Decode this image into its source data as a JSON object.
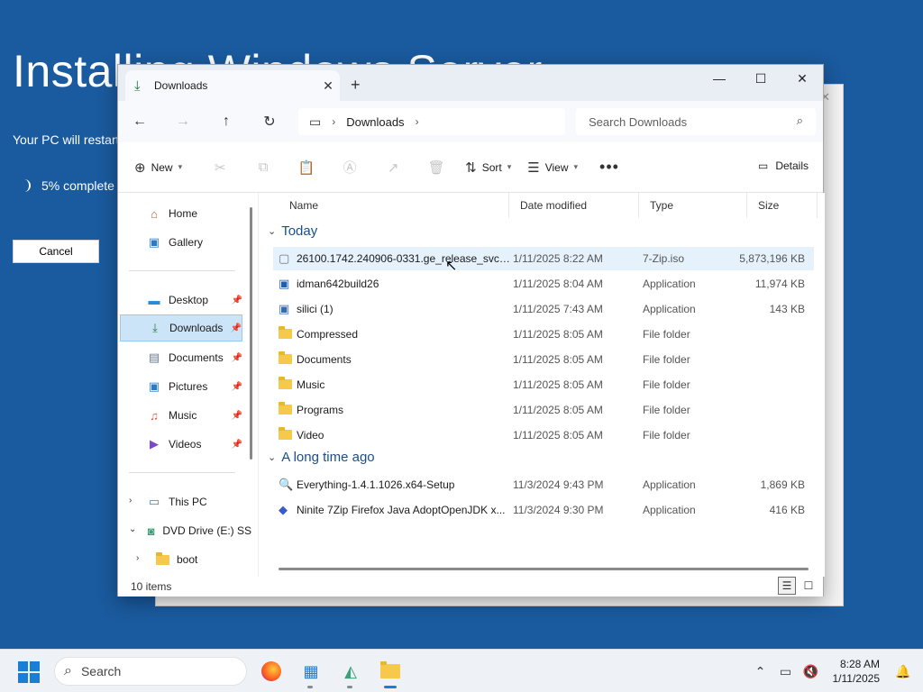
{
  "installer": {
    "title": "Installing Windows Server",
    "restart_text": "Your PC will restart several times.",
    "progress_text": "5% complete",
    "cancel_label": "Cancel"
  },
  "explorer": {
    "tab_label": "Downloads",
    "address": {
      "segment": "Downloads"
    },
    "search_placeholder": "Search Downloads",
    "toolbar": {
      "new_label": "New",
      "sort_label": "Sort",
      "view_label": "View",
      "details_label": "Details"
    },
    "sidebar": {
      "quick": [
        {
          "label": "Home",
          "icon": "home-icon"
        },
        {
          "label": "Gallery",
          "icon": "gallery-icon"
        }
      ],
      "pinned": [
        {
          "label": "Desktop",
          "icon": "desktop-icon"
        },
        {
          "label": "Downloads",
          "icon": "download-icon",
          "active": true
        },
        {
          "label": "Documents",
          "icon": "documents-icon"
        },
        {
          "label": "Pictures",
          "icon": "pictures-icon"
        },
        {
          "label": "Music",
          "icon": "music-icon"
        },
        {
          "label": "Videos",
          "icon": "videos-icon"
        }
      ],
      "tree": [
        {
          "label": "This PC",
          "icon": "pc-icon"
        },
        {
          "label": "DVD Drive (E:) SS",
          "icon": "dvd-drive-icon"
        },
        {
          "label": "boot",
          "icon": "folder-icon"
        }
      ]
    },
    "columns": [
      "Name",
      "Date modified",
      "Type",
      "Size"
    ],
    "groups": [
      {
        "label": "Today",
        "rows": [
          {
            "name": "26100.1742.240906-0331.ge_release_svc_r...",
            "date": "1/11/2025 8:22 AM",
            "type": "7-Zip.iso",
            "size": "5,873,196 KB",
            "icon": "iso-file-icon",
            "selected": true
          },
          {
            "name": "idman642build26",
            "date": "1/11/2025 8:04 AM",
            "type": "Application",
            "size": "11,974 KB",
            "icon": "installer-icon"
          },
          {
            "name": "silici (1)",
            "date": "1/11/2025 7:43 AM",
            "type": "Application",
            "size": "143 KB",
            "icon": "app-icon"
          },
          {
            "name": "Compressed",
            "date": "1/11/2025 8:05 AM",
            "type": "File folder",
            "size": "",
            "icon": "folder-icon"
          },
          {
            "name": "Documents",
            "date": "1/11/2025 8:05 AM",
            "type": "File folder",
            "size": "",
            "icon": "folder-icon"
          },
          {
            "name": "Music",
            "date": "1/11/2025 8:05 AM",
            "type": "File folder",
            "size": "",
            "icon": "folder-icon"
          },
          {
            "name": "Programs",
            "date": "1/11/2025 8:05 AM",
            "type": "File folder",
            "size": "",
            "icon": "folder-icon"
          },
          {
            "name": "Video",
            "date": "1/11/2025 8:05 AM",
            "type": "File folder",
            "size": "",
            "icon": "folder-icon"
          }
        ]
      },
      {
        "label": "A long time ago",
        "rows": [
          {
            "name": "Everything-1.4.1.1026.x64-Setup",
            "date": "11/3/2024 9:43 PM",
            "type": "Application",
            "size": "1,869 KB",
            "icon": "search-app-icon"
          },
          {
            "name": "Ninite 7Zip Firefox Java AdoptOpenJDK x...",
            "date": "11/3/2024 9:30 PM",
            "type": "Application",
            "size": "416 KB",
            "icon": "ninite-icon"
          }
        ]
      }
    ],
    "status": "10 items"
  },
  "taskbar": {
    "search_placeholder": "Search",
    "time": "8:28 AM",
    "date": "1/11/2025"
  },
  "colors": {
    "installer_bg": "#1a5a9e",
    "accent": "#1a7fd4",
    "folder": "#f6c84c",
    "selection": "#cce4f7"
  }
}
